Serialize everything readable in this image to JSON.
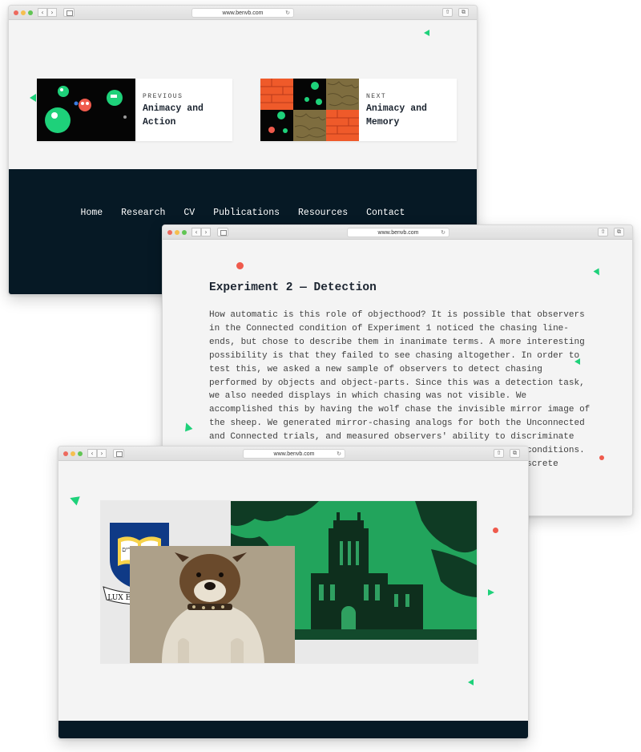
{
  "browser": {
    "url": "www.benvb.com"
  },
  "window1": {
    "prev_card": {
      "kicker": "PREVIOUS",
      "title": "Animacy and Action"
    },
    "next_card": {
      "kicker": "NEXT",
      "title": "Animacy and Memory"
    },
    "footer_nav": [
      "Home",
      "Research",
      "CV",
      "Publications",
      "Resources",
      "Contact"
    ]
  },
  "window2": {
    "heading": "Experiment 2 — Detection",
    "body_lines": [
      "How automatic is this role of objecthood? It is possible that observers",
      "in the Connected condition of Experiment 1 noticed the chasing line-",
      "ends, but chose to describe them in inanimate terms. A more interesting",
      "possibility is that they failed to see chasing altogether. In order to",
      "test this, we asked a new sample of observers to detect chasing",
      "performed by objects and object-parts. Since this was a detection task,",
      "we also needed displays in which chasing was not visible. We",
      "accomplished this by having the wolf chase the invisible mirror image of",
      "the sheep. We generated mirror-chasing analogs for both the Unconnected",
      "and Connected trials, and measured observers' ability to discriminate",
      "                                                            conditions.",
      "                                                            screte"
    ]
  },
  "window3": {
    "crest_motto": "LUX ET VERITAS",
    "crest_book_text": "אורים ותמים"
  },
  "colors": {
    "accent_green": "#1ed17a",
    "accent_red": "#ef5a4c",
    "footer_navy": "#061925"
  }
}
